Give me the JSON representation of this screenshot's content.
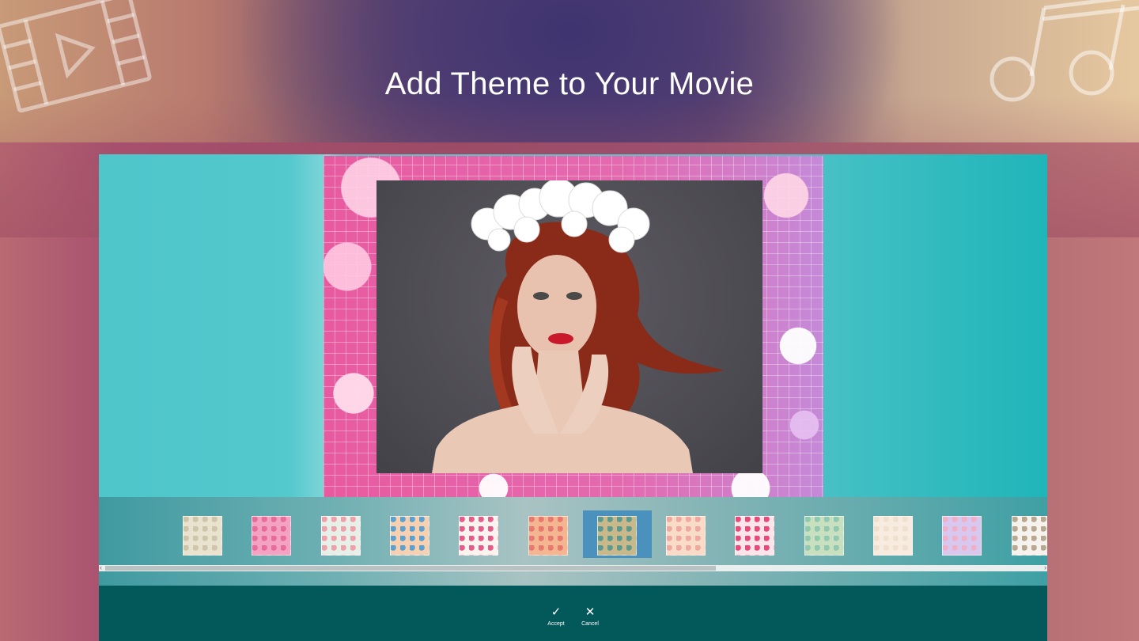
{
  "headline": "Add Theme to Your Movie",
  "decorations": {
    "left_icon": "film-play-icon",
    "right_icon": "music-note-icon"
  },
  "themes": [
    {
      "name": "beige-plaid",
      "c1": "#e9e2cf",
      "c2": "#cfc5a8"
    },
    {
      "name": "pink-floral",
      "c1": "#f4a2c2",
      "c2": "#e86b9a"
    },
    {
      "name": "mint-dots",
      "c1": "#e6efe8",
      "c2": "#f0a0a8"
    },
    {
      "name": "colorful-flowers",
      "c1": "#f6d0b0",
      "c2": "#5aa0d0"
    },
    {
      "name": "confetti-dots",
      "c1": "#fbf4ee",
      "c2": "#e85a8a"
    },
    {
      "name": "autumn-leaves",
      "c1": "#f3b690",
      "c2": "#e87870"
    },
    {
      "name": "retro-leaves",
      "c1": "#c9b88a",
      "c2": "#5a9a90",
      "selected": true
    },
    {
      "name": "peach-hearts",
      "c1": "#f8dcc8",
      "c2": "#f0a8a0"
    },
    {
      "name": "pink-polka",
      "c1": "#fbe4ea",
      "c2": "#e84a7a"
    },
    {
      "name": "green-leaves",
      "c1": "#c8e0c0",
      "c2": "#90c8b0"
    },
    {
      "name": "cream-plain",
      "c1": "#f8ece0",
      "c2": "#efe0d0"
    },
    {
      "name": "watercolor",
      "c1": "#d8c8f0",
      "c2": "#f0b0c8"
    },
    {
      "name": "neutral-circles",
      "c1": "#f6f2ee",
      "c2": "#b8a890"
    }
  ],
  "commands": {
    "accept_label": "Accept",
    "cancel_label": "Cancel",
    "accept_glyph": "✓",
    "cancel_glyph": "✕"
  },
  "colors": {
    "app_teal": "#4ec6ca",
    "command_bar": "#03585a",
    "selection": "#4a92bd",
    "frame_pink": "#e75aa2"
  },
  "scroll": {
    "position": 0.0,
    "visible_fraction": 0.65
  }
}
